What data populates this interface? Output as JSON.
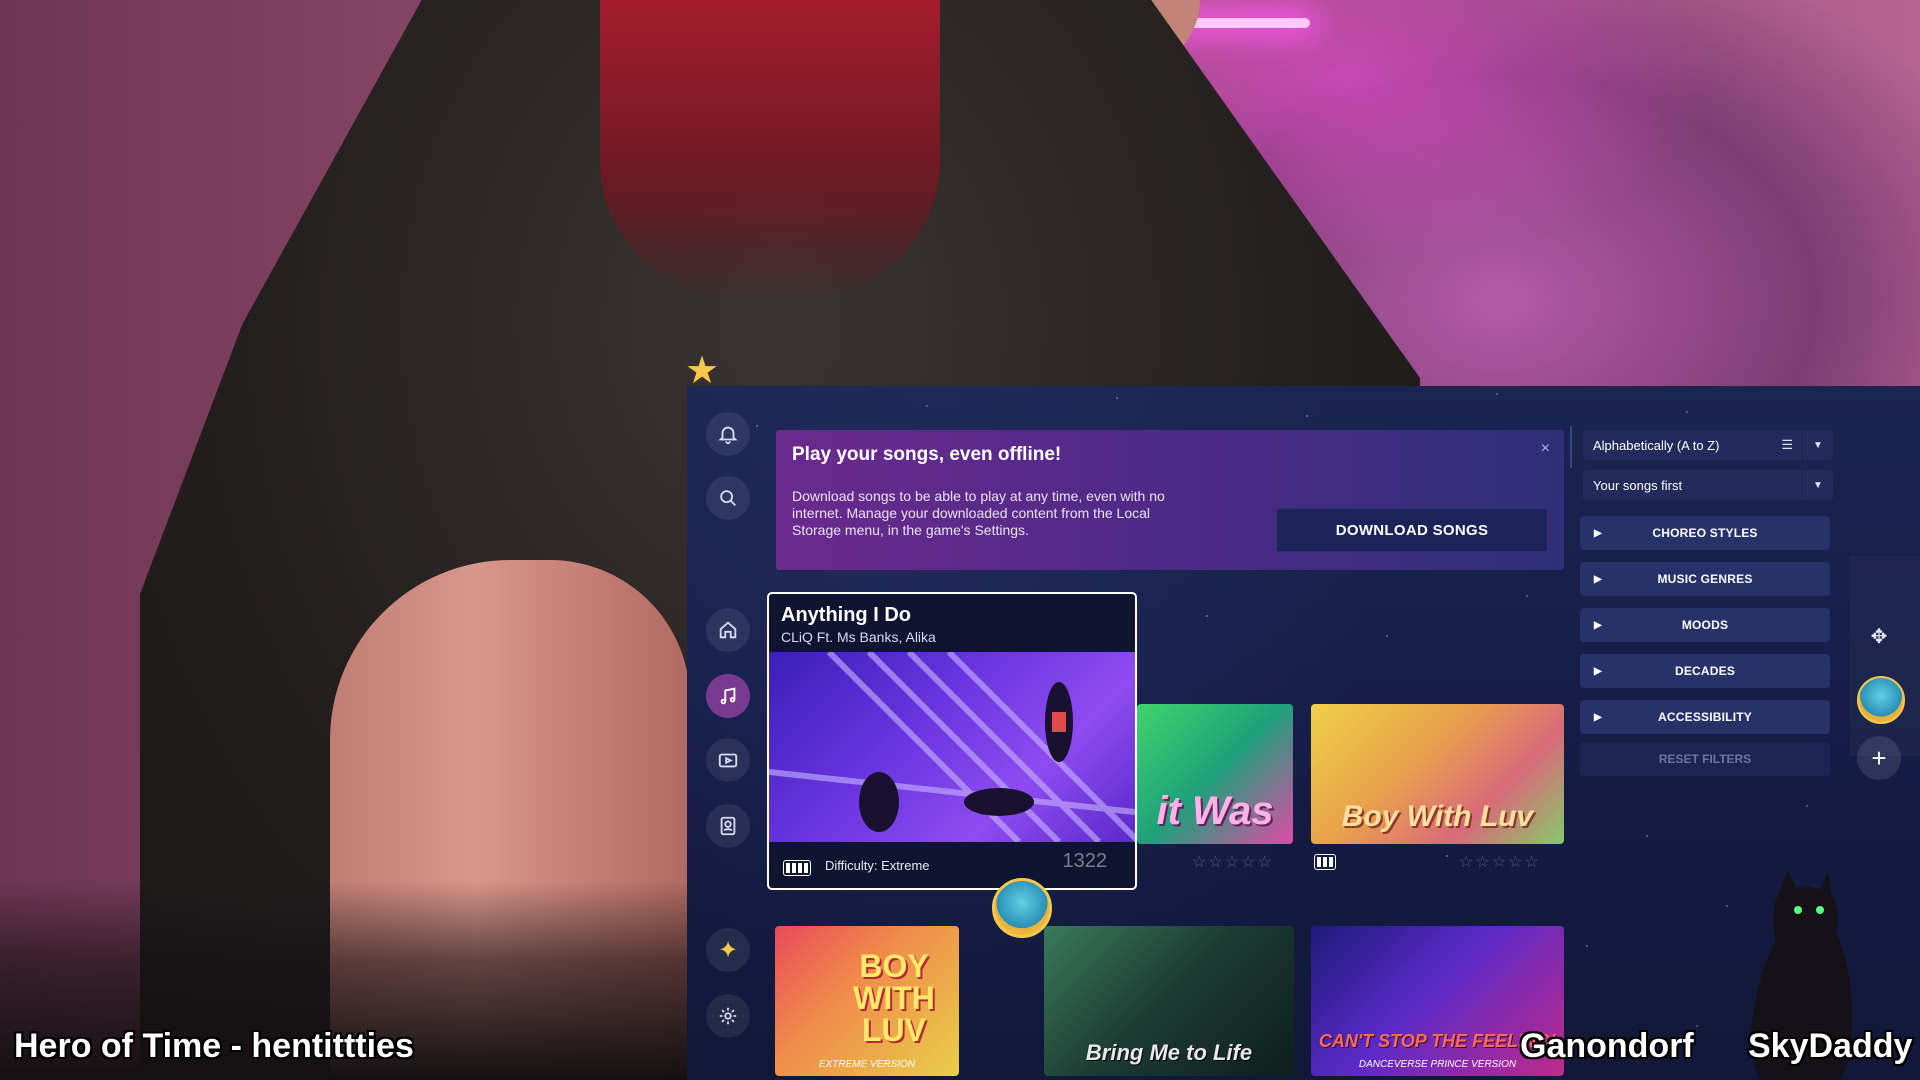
{
  "stream": {
    "left_overlay": "Hero of Time - hentittties",
    "right_overlay_1": "Ganondorf",
    "right_overlay_2": "SkyDaddy"
  },
  "banner": {
    "title": "Play your songs, even offline!",
    "body": "Download songs to be able to play at any time, even with no internet. Manage your downloaded content from the Local Storage menu, in the game's Settings.",
    "close_icon": "×",
    "download_label": "DOWNLOAD SONGS"
  },
  "featured": {
    "title": "Anything I Do",
    "artist": "CLiQ Ft. Ms Banks, Alika",
    "difficulty": "Difficulty: Extreme",
    "difficulty_level": 4,
    "score": "1322"
  },
  "tiles": [
    {
      "label": "it Was"
    },
    {
      "label": "Boy With Luv"
    },
    {
      "label": "BOY WITH LUV",
      "sub": "EXTREME VERSION"
    },
    {
      "label": "Bring Me to Life"
    },
    {
      "label": "CAN'T STOP THE FEELING!",
      "sub": "DANCEVERSE PRINCE VERSION"
    }
  ],
  "filters": {
    "sort_value": "Alphabetically (A to Z)",
    "order_value": "Your songs first",
    "sections": [
      "CHOREO STYLES",
      "MUSIC GENRES",
      "MOODS",
      "DECADES",
      "ACCESSIBILITY"
    ],
    "reset_label": "RESET FILTERS"
  },
  "sidebar": [
    "bell-icon",
    "search-icon",
    "home-icon",
    "music-note-icon",
    "video-icon",
    "profile-icon",
    "sparkle-icon",
    "gear-icon"
  ],
  "right_rail": [
    "controller-icon",
    "avatar",
    "plus-icon"
  ],
  "colors": {
    "accent_purple": "#7a3a8f",
    "panel_bg": "#141c44",
    "button_bg": "#28326a"
  }
}
